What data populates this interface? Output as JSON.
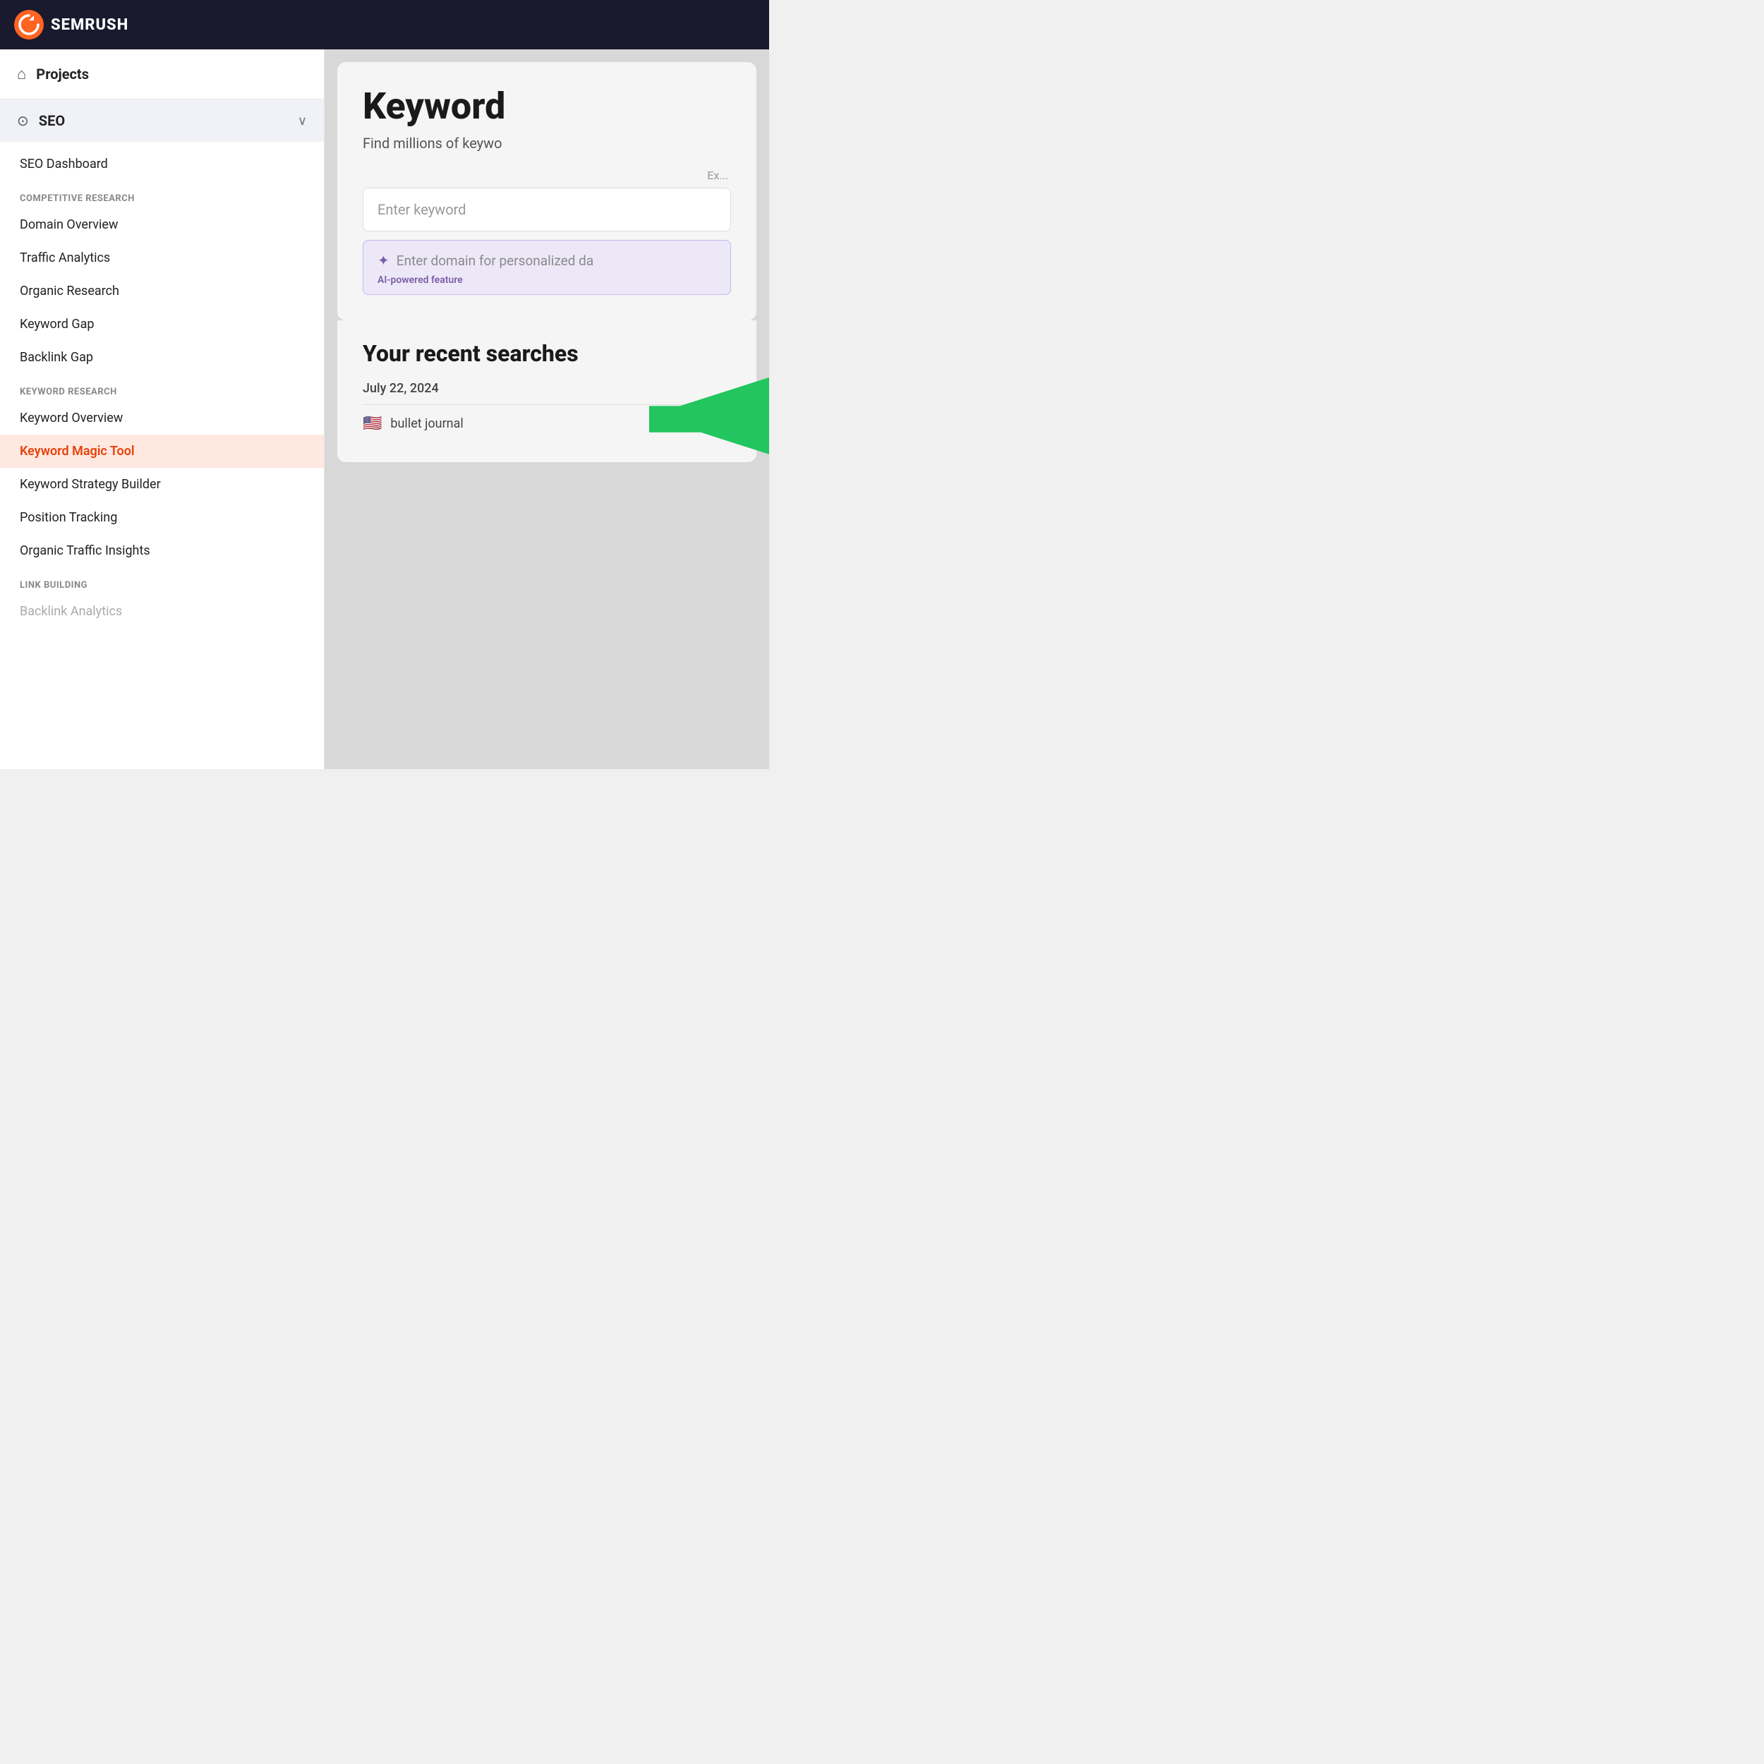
{
  "header": {
    "logo_text": "SEMRUSH"
  },
  "sidebar": {
    "projects_label": "Projects",
    "seo_label": "SEO",
    "seo_dashboard_label": "SEO Dashboard",
    "sections": [
      {
        "id": "competitive-research",
        "label": "COMPETITIVE RESEARCH",
        "items": [
          {
            "id": "domain-overview",
            "label": "Domain Overview",
            "active": false
          },
          {
            "id": "traffic-analytics",
            "label": "Traffic Analytics",
            "active": false
          },
          {
            "id": "organic-research",
            "label": "Organic Research",
            "active": false
          },
          {
            "id": "keyword-gap",
            "label": "Keyword Gap",
            "active": false
          },
          {
            "id": "backlink-gap",
            "label": "Backlink Gap",
            "active": false
          }
        ]
      },
      {
        "id": "keyword-research",
        "label": "KEYWORD RESEARCH",
        "items": [
          {
            "id": "keyword-overview",
            "label": "Keyword Overview",
            "active": false
          },
          {
            "id": "keyword-magic-tool",
            "label": "Keyword Magic Tool",
            "active": true
          },
          {
            "id": "keyword-strategy-builder",
            "label": "Keyword Strategy Builder",
            "active": false
          },
          {
            "id": "position-tracking",
            "label": "Position Tracking",
            "active": false
          },
          {
            "id": "organic-traffic-insights",
            "label": "Organic Traffic Insights",
            "active": false
          }
        ]
      },
      {
        "id": "link-building",
        "label": "LINK BUILDING",
        "items": [
          {
            "id": "backlink-analytics",
            "label": "Backlink Analytics",
            "active": false
          }
        ]
      }
    ]
  },
  "main_content": {
    "title": "Keyword",
    "subtitle": "Find millions of keywo",
    "example_label": "Ex...",
    "search_placeholder": "Enter keyword",
    "ai_placeholder": "Enter domain for personalized da",
    "ai_badge": "AI-powered feature",
    "recent_searches_title": "Your recent searches",
    "date_label": "July 22, 2024",
    "search_result": "bullet journal"
  },
  "arrow": {
    "color": "#22c55e"
  }
}
